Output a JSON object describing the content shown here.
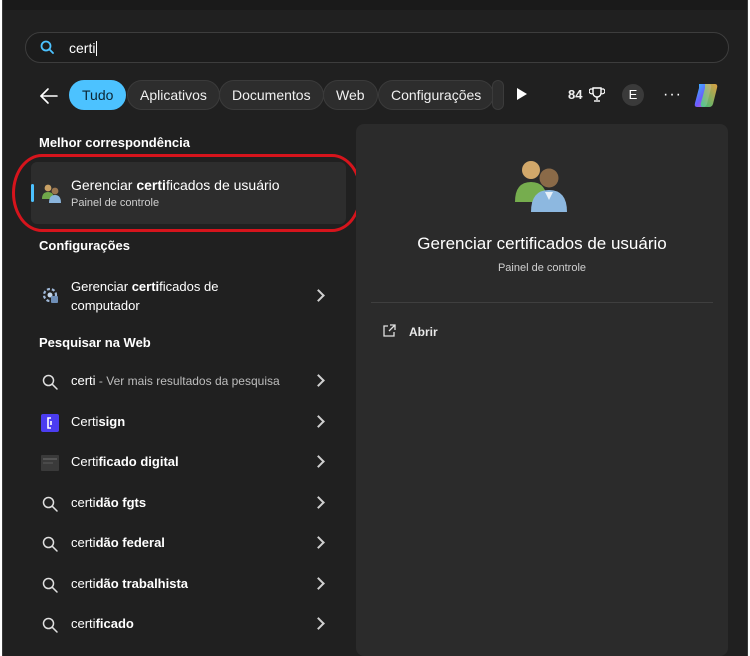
{
  "search": {
    "query": "certi"
  },
  "filters": {
    "tabs": [
      "Tudo",
      "Aplicativos",
      "Documentos",
      "Web",
      "Configurações"
    ],
    "points": "84",
    "account_initial": "E",
    "more": "···"
  },
  "best_match": {
    "heading": "Melhor correspondência",
    "title_pre": "Gerenciar ",
    "title_bold": "certi",
    "title_post": "ficados de usuário",
    "subtitle": "Painel de controle"
  },
  "settings": {
    "heading": "Configurações",
    "item": {
      "line1_pre": "Gerenciar ",
      "line1_bold": "certi",
      "line1_post": "ficados de",
      "line2": "computador"
    }
  },
  "web": {
    "heading": "Pesquisar na Web",
    "items": [
      {
        "pre": "certi",
        "bold": "",
        "suffix": " - Ver mais resultados da pesquisa",
        "icon": "search-icon"
      },
      {
        "pre": "Certi",
        "bold": "sign",
        "suffix": "",
        "icon": "certisign-icon"
      },
      {
        "pre": "Certi",
        "bold": "ficado digital",
        "suffix": "",
        "icon": "thumbnail-icon"
      },
      {
        "pre": "certi",
        "bold": "dão fgts",
        "suffix": "",
        "icon": "search-icon"
      },
      {
        "pre": "certi",
        "bold": "dão federal",
        "suffix": "",
        "icon": "search-icon"
      },
      {
        "pre": "certi",
        "bold": "dão trabalhista",
        "suffix": "",
        "icon": "search-icon"
      },
      {
        "pre": "certi",
        "bold": "ficado",
        "suffix": "",
        "icon": "search-icon"
      }
    ]
  },
  "preview": {
    "title": "Gerenciar certificados de usuário",
    "subtitle": "Painel de controle",
    "open_label": "Abrir"
  },
  "colors": {
    "accent": "#4cc2ff",
    "highlight": "#d6141c",
    "panel": "#202020"
  }
}
